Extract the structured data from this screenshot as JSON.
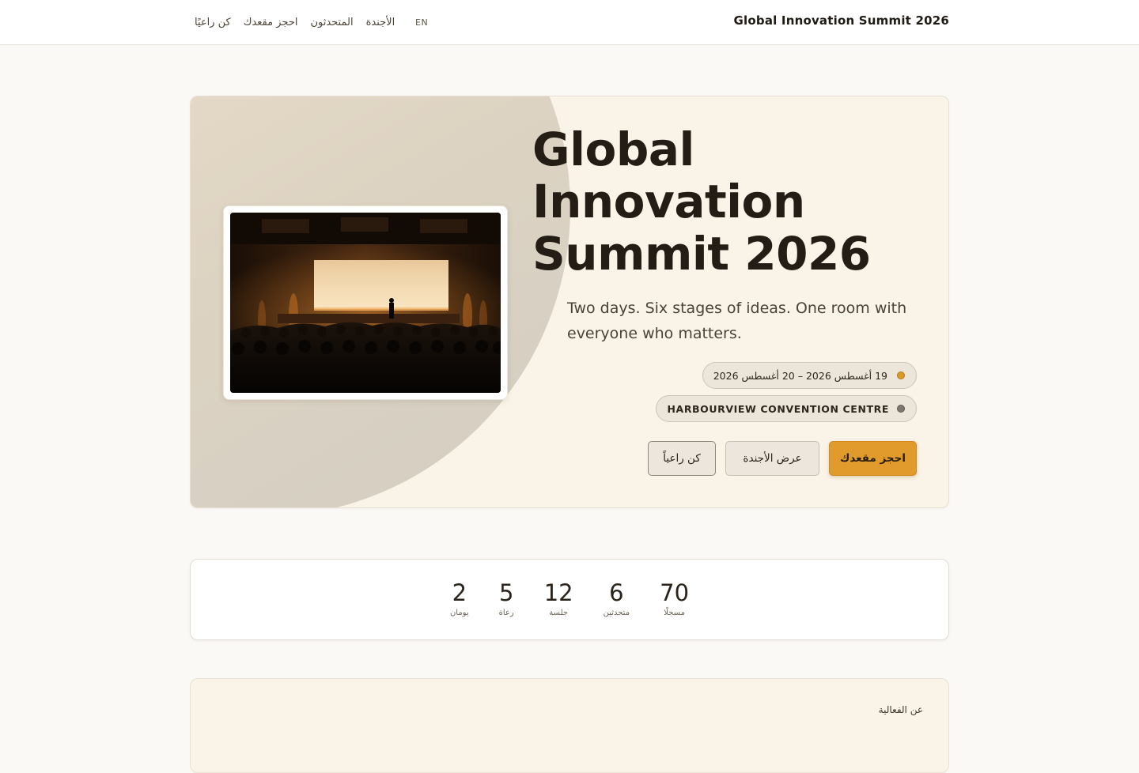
{
  "header": {
    "brand": "Global Innovation Summit 2026",
    "nav": [
      {
        "id": "sponsor",
        "label": "كن راعيًا"
      },
      {
        "id": "book",
        "label": "احجز مقعدك"
      },
      {
        "id": "speakers",
        "label": "المتحدثون"
      },
      {
        "id": "agenda",
        "label": "الأجندة"
      }
    ],
    "lang_toggle": "EN"
  },
  "hero": {
    "title": "Global Innovation Summit 2026",
    "subtitle": "Two days. Six stages of ideas. One room with everyone who matters.",
    "date_pill": "19 أغسطس 2026 – 20 أغسطس 2026",
    "venue_pill": "HARBOURVIEW CONVENTION CENTRE",
    "buttons": {
      "primary": "احجز مقعدك",
      "agenda": "عرض الأجندة",
      "sponsor": "كن راعياً"
    },
    "image": {
      "icon": "auditorium-photo"
    }
  },
  "stats": [
    {
      "value": "2",
      "label": "يومان"
    },
    {
      "value": "5",
      "label": "رعاة"
    },
    {
      "value": "12",
      "label": "جلسة"
    },
    {
      "value": "6",
      "label": "متحدثين"
    },
    {
      "value": "70",
      "label": "مسجلًا"
    }
  ],
  "about": {
    "eyebrow": "عن الفعالية"
  },
  "colors": {
    "accent": "#e19a2c",
    "background": "#fbf9f6",
    "hero_bg": "#faf3e8",
    "text": "#231d15"
  }
}
